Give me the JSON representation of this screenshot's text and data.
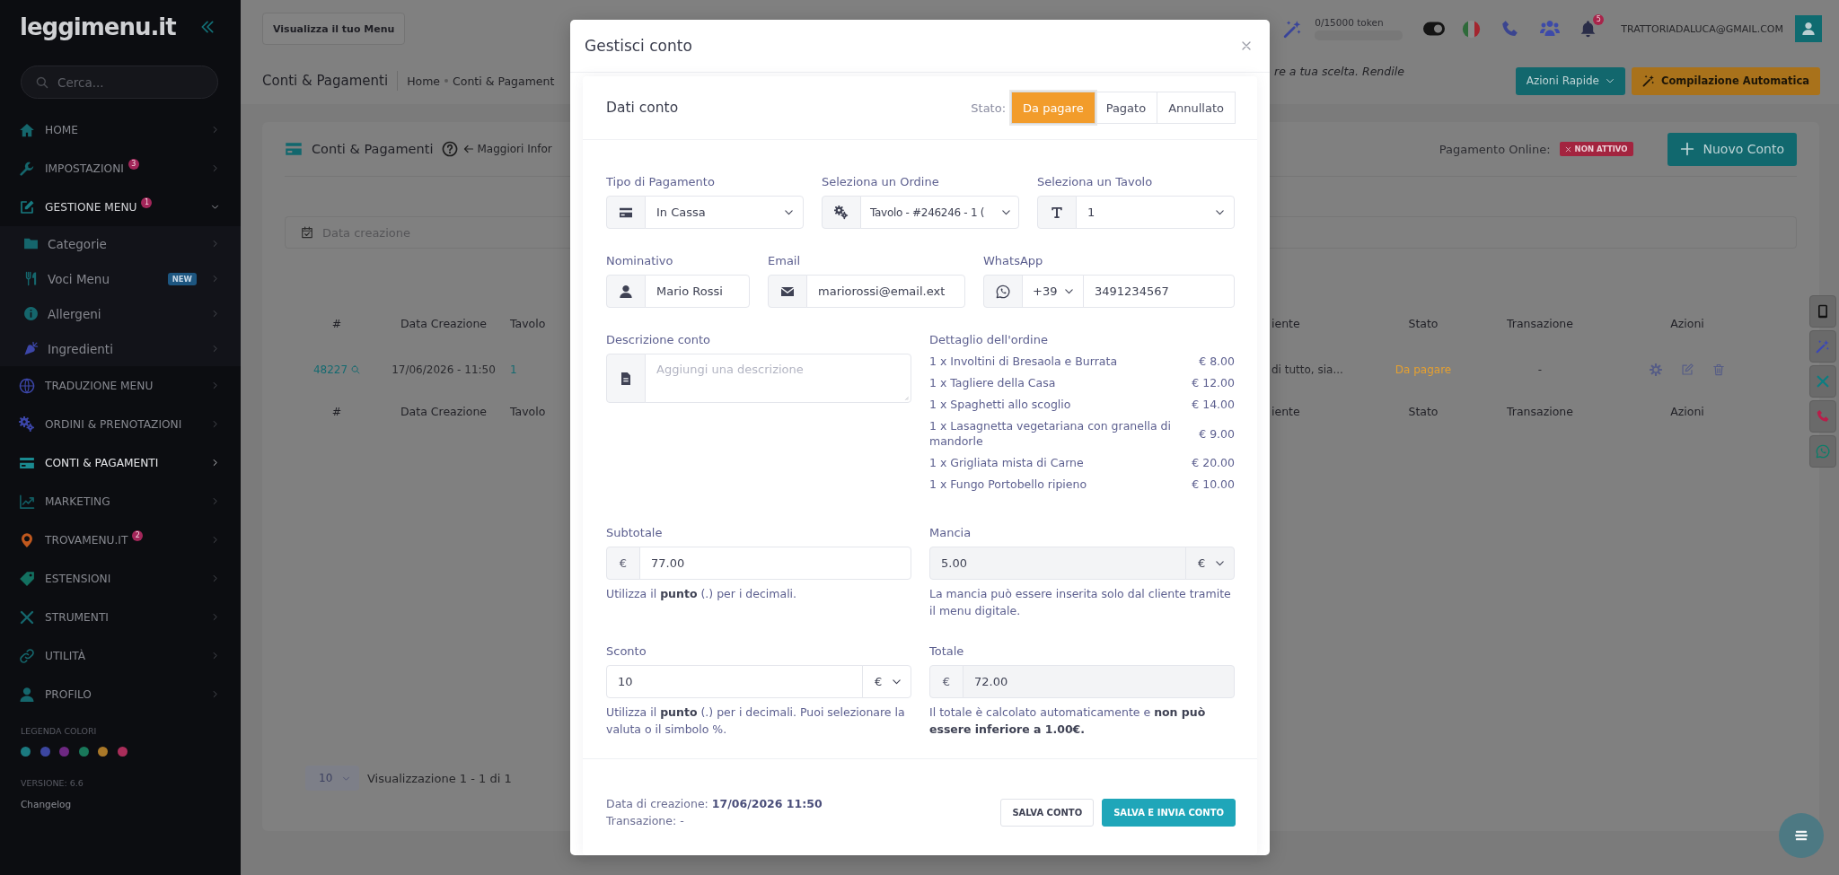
{
  "sidebar": {
    "logo": "leggimenu.it",
    "search": {
      "placeholder": "Cerca..."
    },
    "items": [
      {
        "label": "HOME",
        "color": "#15666c",
        "selected": false,
        "expanded": false
      },
      {
        "label": "IMPOSTAZIONI",
        "badge": "3",
        "color": "#15666c",
        "selected": false,
        "expanded": false
      },
      {
        "label": "GESTIONE MENU",
        "badge": "1",
        "color": "#177a80",
        "selected": false,
        "expanded": true,
        "children": [
          {
            "label": "Categorie",
            "color": "#15666c",
            "selected": false
          },
          {
            "label": "Voci Menu",
            "tag": "NEW",
            "color": "#15666c",
            "selected": false
          },
          {
            "label": "Allergeni",
            "color": "#15666c",
            "selected": false
          },
          {
            "label": "Ingredienti",
            "color": "#3c46a8",
            "selected": false
          }
        ]
      },
      {
        "label": "TRADUZIONE MENU",
        "color": "#3c46a8",
        "selected": false,
        "expanded": false
      },
      {
        "label": "ORDINI & PRENOTAZIONI",
        "color": "#3c46a8",
        "selected": false,
        "expanded": false
      },
      {
        "label": "CONTI & PAGAMENTI",
        "color": "#1a8a90",
        "selected": true,
        "expanded": false
      },
      {
        "label": "MARKETING",
        "color": "#125c62",
        "selected": false,
        "expanded": false
      },
      {
        "label": "TROVAMENU.IT",
        "badge": "2",
        "color": "#c0581e",
        "selected": false,
        "expanded": false
      },
      {
        "label": "ESTENSIONI",
        "color": "#137060",
        "selected": false,
        "expanded": false
      },
      {
        "label": "STRUMENTI",
        "color": "#15666c",
        "selected": false,
        "expanded": false
      },
      {
        "label": "UTILITÀ",
        "color": "#15666c",
        "selected": false,
        "expanded": false
      },
      {
        "label": "PROFILO",
        "color": "#15666c",
        "selected": false,
        "expanded": false
      }
    ],
    "legend": {
      "title": "LEGENDA COLORI",
      "colors": [
        {
          "color": "#1b7a80"
        },
        {
          "color": "#3c46a0"
        },
        {
          "color": "#6e2882"
        },
        {
          "color": "#19785a"
        },
        {
          "color": "#aa7828"
        },
        {
          "color": "#aa2d5a"
        }
      ]
    },
    "version": "VERSIONE: 6.6",
    "changelog": "Changelog"
  },
  "topbar": {
    "view_menu_button": "Visualizza il tuo Menu",
    "tokens": {
      "label": "0/15000 token",
      "level": 0
    },
    "notifications": "5",
    "email": "TRATTORIADALUCA@GMAIL.COM"
  },
  "page_header": {
    "title": "Conti & Pagamenti",
    "breadcrumb": [
      "Home",
      "Conti & Pagament"
    ],
    "announcement": "re a tua scelta. Rendile",
    "buttons": [
      {
        "label": "Azioni Rapide",
        "kind": "dropdown"
      },
      {
        "label": "Compilazione Automatica",
        "kind": "magic"
      }
    ]
  },
  "card": {
    "title": "Conti & Pagamenti",
    "help_link": "Maggiori Infor",
    "online_payment": {
      "label": "Pagamento Online:",
      "status": "NON ATTIVO",
      "active": false
    },
    "new_button": "Nuovo Conto",
    "filter": {
      "placeholder": "Data creazione"
    },
    "table": {
      "columns": [
        "#",
        "Data Creazione",
        "Tavolo",
        "iente",
        "Stato",
        "Transazione",
        "Azioni"
      ],
      "rows": [
        {
          "cells": [
            "48227",
            "17/06/2026 - 11:50",
            "1",
            "di tutto, sia...",
            "Da pagare",
            "-"
          ]
        }
      ],
      "footer_columns": [
        "#",
        "Data Creazione",
        "Tavolo",
        "iente",
        "Stato",
        "Transazione",
        "Azioni"
      ]
    },
    "pagination": {
      "page_size": "10",
      "summary": "Visualizzazione 1 - 1 di 1"
    }
  },
  "modal": {
    "title": "Gestisci conto",
    "section_title": "Dati conto",
    "status_label": "Stato:",
    "statuses": [
      {
        "label": "Da pagare",
        "selected": true
      },
      {
        "label": "Pagato",
        "selected": false
      },
      {
        "label": "Annullato",
        "selected": false
      }
    ],
    "payment_type": {
      "label": "Tipo di Pagamento",
      "value": "In Cassa"
    },
    "order": {
      "label": "Seleziona un Ordine",
      "value": "Tavolo - #246246 - 1 ("
    },
    "table": {
      "label": "Seleziona un Tavolo",
      "value": "1"
    },
    "name": {
      "label": "Nominativo",
      "value": "Mario Rossi"
    },
    "email": {
      "label": "Email",
      "value": "mariorossi@email.ext"
    },
    "whatsapp": {
      "label": "WhatsApp",
      "prefix": "+39",
      "value": "3491234567"
    },
    "description": {
      "label": "Descrizione conto",
      "placeholder": "Aggiungi una descrizione"
    },
    "order_detail": {
      "title": "Dettaglio dell'ordine",
      "items": [
        {
          "name": "1 x Involtini di Bresaola e Burrata",
          "price": "€ 8.00"
        },
        {
          "name": "1 x Tagliere della Casa",
          "price": "€ 12.00"
        },
        {
          "name": "1 x Spaghetti allo scoglio",
          "price": "€ 14.00"
        },
        {
          "name": "1 x Lasagnetta vegetariana con granella di mandorle",
          "price": "€ 9.00"
        },
        {
          "name": "1 x Grigliata mista di Carne",
          "price": "€ 20.00"
        },
        {
          "name": "1 x Fungo Portobello ripieno",
          "price": "€ 10.00"
        }
      ]
    },
    "subtotal": {
      "label": "Subtotale",
      "currency": "€",
      "value": "77.00",
      "disabled": false,
      "help": "Utilizza il **punto** (.) per i decimali."
    },
    "tip": {
      "label": "Mancia",
      "value": "5.00",
      "currency": "€",
      "disabled": true,
      "help": "La mancia può essere inserita solo dal cliente tramite il menu digitale."
    },
    "discount": {
      "label": "Sconto",
      "value": "10",
      "currency": "€",
      "disabled": false,
      "help": "Utilizza il **punto** (.) per i decimali. Puoi selezionare la valuta o il simbolo %."
    },
    "total": {
      "label": "Totale",
      "currency": "€",
      "value": "72.00",
      "disabled": true,
      "help": "Il totale è calcolato automaticamente e **non può essere inferiore a 1.00€.**"
    },
    "footer": {
      "created": "Data di creazione: **17/06/2026 11:50**",
      "transaction": "Transazione: -"
    },
    "buttons": [
      {
        "label": "SALVA CONTO",
        "kind": "outline"
      },
      {
        "label": "SALVA E INVIA CONTO",
        "kind": "primary"
      }
    ]
  }
}
